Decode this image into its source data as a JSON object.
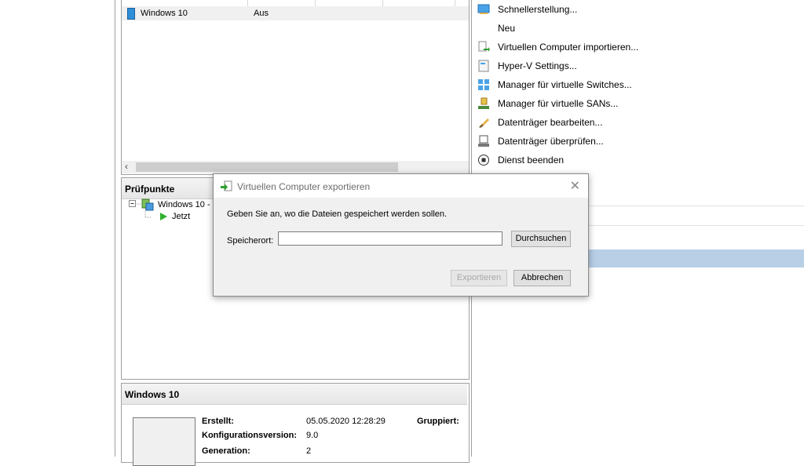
{
  "vm_list": {
    "rows": [
      {
        "name": "Windows 10",
        "state": "Aus"
      }
    ]
  },
  "checkpoints": {
    "title": "Prüfpunkte",
    "tree_root": "Windows 10 - (",
    "tree_child": "Jetzt"
  },
  "details": {
    "title": "Windows 10",
    "created_label": "Erstellt:",
    "created_value": "05.05.2020 12:28:29",
    "grouped_label": "Gruppiert:",
    "config_label": "Konfigurationsversion:",
    "config_value": "9.0",
    "generation_label": "Generation:",
    "generation_value": "2"
  },
  "actions": {
    "items": [
      {
        "label": "Schnellerstellung...",
        "icon": "quick-create-icon"
      },
      {
        "label": "Neu",
        "icon": ""
      },
      {
        "label": "Virtuellen Computer importieren...",
        "icon": "import-icon"
      },
      {
        "label": "Hyper-V Settings...",
        "icon": "settings-icon"
      },
      {
        "label": "Manager für virtuelle Switches...",
        "icon": "switch-icon"
      },
      {
        "label": "Manager für virtuelle SANs...",
        "icon": "san-icon"
      },
      {
        "label": "Datenträger bearbeiten...",
        "icon": "disk-edit-icon"
      },
      {
        "label": "Datenträger überprüfen...",
        "icon": "disk-inspect-icon"
      },
      {
        "label": "Dienst beenden",
        "icon": "stop-icon"
      }
    ]
  },
  "dialog": {
    "title": "Virtuellen Computer exportieren",
    "instruction": "Geben Sie an, wo die Dateien gespeichert werden sollen.",
    "location_label": "Speicherort:",
    "location_value": "",
    "browse_label": "Durchsuchen",
    "export_label": "Exportieren",
    "cancel_label": "Abbrechen"
  },
  "colors": {
    "selection": "#b8cfe6",
    "dialog_bg": "#f0f0f0"
  }
}
